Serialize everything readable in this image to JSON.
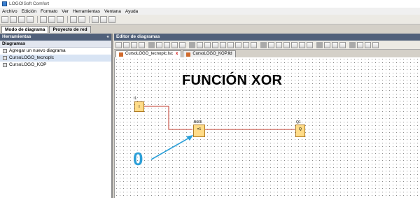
{
  "window": {
    "title": "LOGO!Soft Comfort"
  },
  "menu": [
    "Archivo",
    "Edición",
    "Formato",
    "Ver",
    "Herramientas",
    "Ventana",
    "Ayuda"
  ],
  "mode_tabs": [
    "Modo de diagrama",
    "Proyecto de red"
  ],
  "left_panel": {
    "header": "Herramientas",
    "collapse_glyph": "«",
    "section": "Diagramas",
    "items": [
      "Agregar un nuevo diagrama",
      "CursoLOGO_tecnoplc",
      "CursoLOGO_KOP"
    ]
  },
  "editor": {
    "header": "Editor de diagramas",
    "doc_tabs": [
      "CursoLOGO_tecnoplc.lsc",
      "CursoLOGO_KOP.lld"
    ],
    "close_glyph": "x"
  },
  "diagram": {
    "heading": "FUNCIÓN XOR",
    "input_block": {
      "name": "I1",
      "symbol": "I"
    },
    "xor_block": {
      "name": "B005",
      "symbol": "=1"
    },
    "output_block": {
      "name": "Q1",
      "symbol": "Q"
    },
    "annotation_value": "0",
    "wire_color": "#c0392b",
    "arrow_color": "#2b9fd8"
  }
}
